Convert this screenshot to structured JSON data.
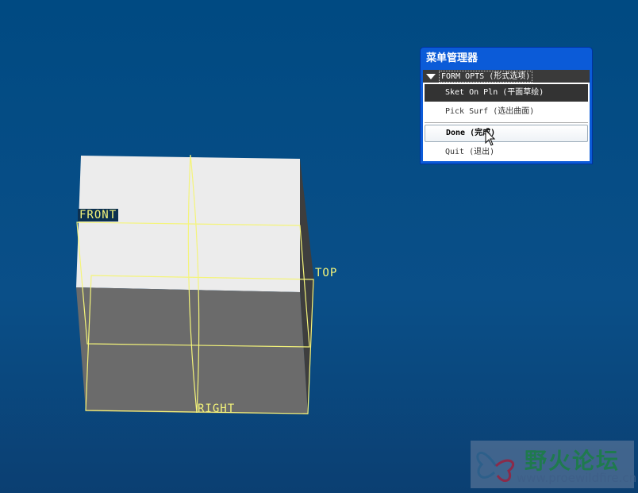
{
  "viewport": {
    "planes": {
      "front": "FRONT",
      "top": "TOP",
      "right": "RIGHT"
    }
  },
  "menu_manager": {
    "title": "菜单管理器",
    "group": "FORM OPTS (形式选项)",
    "items": [
      {
        "label": "Sket On Pln (平面草绘)",
        "state": "selected"
      },
      {
        "label": "Pick Surf (选出曲面)",
        "state": "normal"
      },
      {
        "label": "Done (完成)",
        "state": "hover"
      },
      {
        "label": "Quit (退出)",
        "state": "normal"
      }
    ]
  },
  "watermark": {
    "name": "野火论坛",
    "url": "www.proewildfire.cn"
  },
  "colors": {
    "datum": "#f4f47a",
    "light_face": "#ececec",
    "dark_face": "#6a6a6a"
  }
}
